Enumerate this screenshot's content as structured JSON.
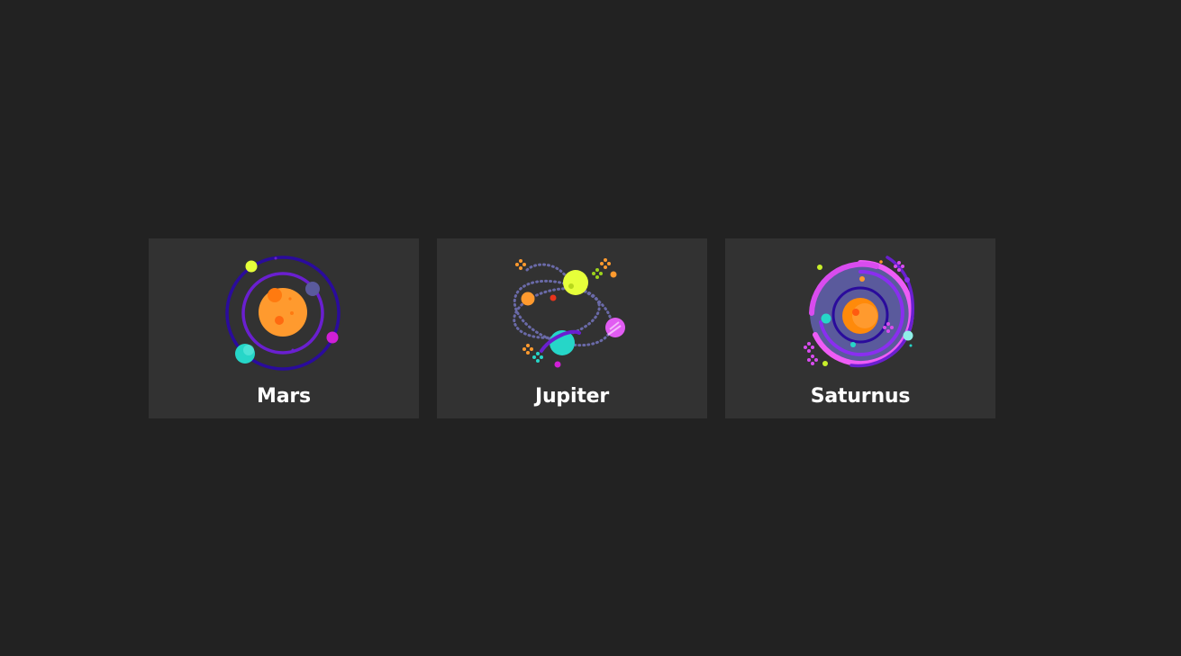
{
  "cards": [
    {
      "label": "Mars",
      "icon": "solar-system-icon"
    },
    {
      "label": "Jupiter",
      "icon": "planet-orbits-icon"
    },
    {
      "label": "Saturnus",
      "icon": "galaxy-icon"
    }
  ],
  "colors": {
    "background": "#222222",
    "card": "#323232",
    "text": "#ffffff",
    "orange": "#ff9a2e",
    "purple": "#6a1fd0",
    "navy": "#2a0b9c",
    "teal": "#26d6c8",
    "lime": "#e6ff3a",
    "magenta": "#d11fd6",
    "pink": "#ee5cf6"
  }
}
